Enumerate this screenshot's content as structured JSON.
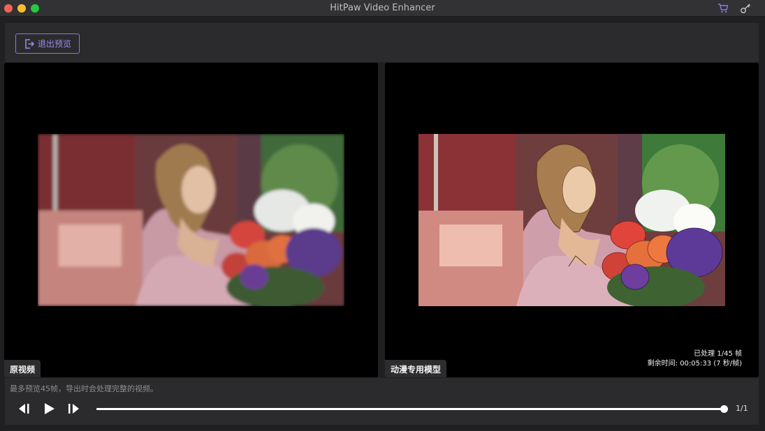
{
  "window": {
    "title": "HitPaw Video Enhancer",
    "icons": [
      "cart-icon",
      "key-icon"
    ]
  },
  "toolbar": {
    "exit_preview_label": "退出预览",
    "exit_icon": "exit-icon",
    "accent_color": "#8b78e6"
  },
  "panes": {
    "left": {
      "label": "原视频"
    },
    "right": {
      "label": "动漫专用模型",
      "processed_text": "已处理 1/45 帧",
      "remaining_text": "剩余时间: 00:05:33 (7 秒/帧)"
    }
  },
  "controls": {
    "hint": "最多预览45帧，导出时会处理完整的视频。",
    "buttons": [
      "prev-frame-icon",
      "play-icon",
      "next-frame-icon"
    ],
    "progress": 1.0,
    "frame_counter": "1/1"
  }
}
